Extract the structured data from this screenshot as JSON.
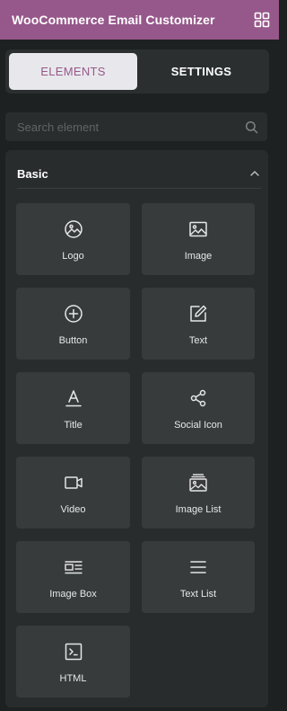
{
  "header": {
    "title": "WooCommerce Email Customizer",
    "grid_icon": "grid-icon",
    "bg": "#96588a"
  },
  "tabs": [
    {
      "label": "ELEMENTS",
      "active": true
    },
    {
      "label": "SETTINGS",
      "active": false
    }
  ],
  "search": {
    "placeholder": "Search element",
    "value": "",
    "icon": "search-icon"
  },
  "section": {
    "title": "Basic",
    "expanded": true,
    "icon": "chevron-up-icon"
  },
  "elements": [
    {
      "label": "Logo",
      "icon": "logo-icon"
    },
    {
      "label": "Image",
      "icon": "image-icon"
    },
    {
      "label": "Button",
      "icon": "button-icon"
    },
    {
      "label": "Text",
      "icon": "text-edit-icon"
    },
    {
      "label": "Title",
      "icon": "title-icon"
    },
    {
      "label": "Social Icon",
      "icon": "share-icon"
    },
    {
      "label": "Video",
      "icon": "video-icon"
    },
    {
      "label": "Image List",
      "icon": "image-list-icon"
    },
    {
      "label": "Image Box",
      "icon": "image-box-icon"
    },
    {
      "label": "Text List",
      "icon": "text-list-icon"
    },
    {
      "label": "HTML",
      "icon": "html-icon"
    }
  ]
}
